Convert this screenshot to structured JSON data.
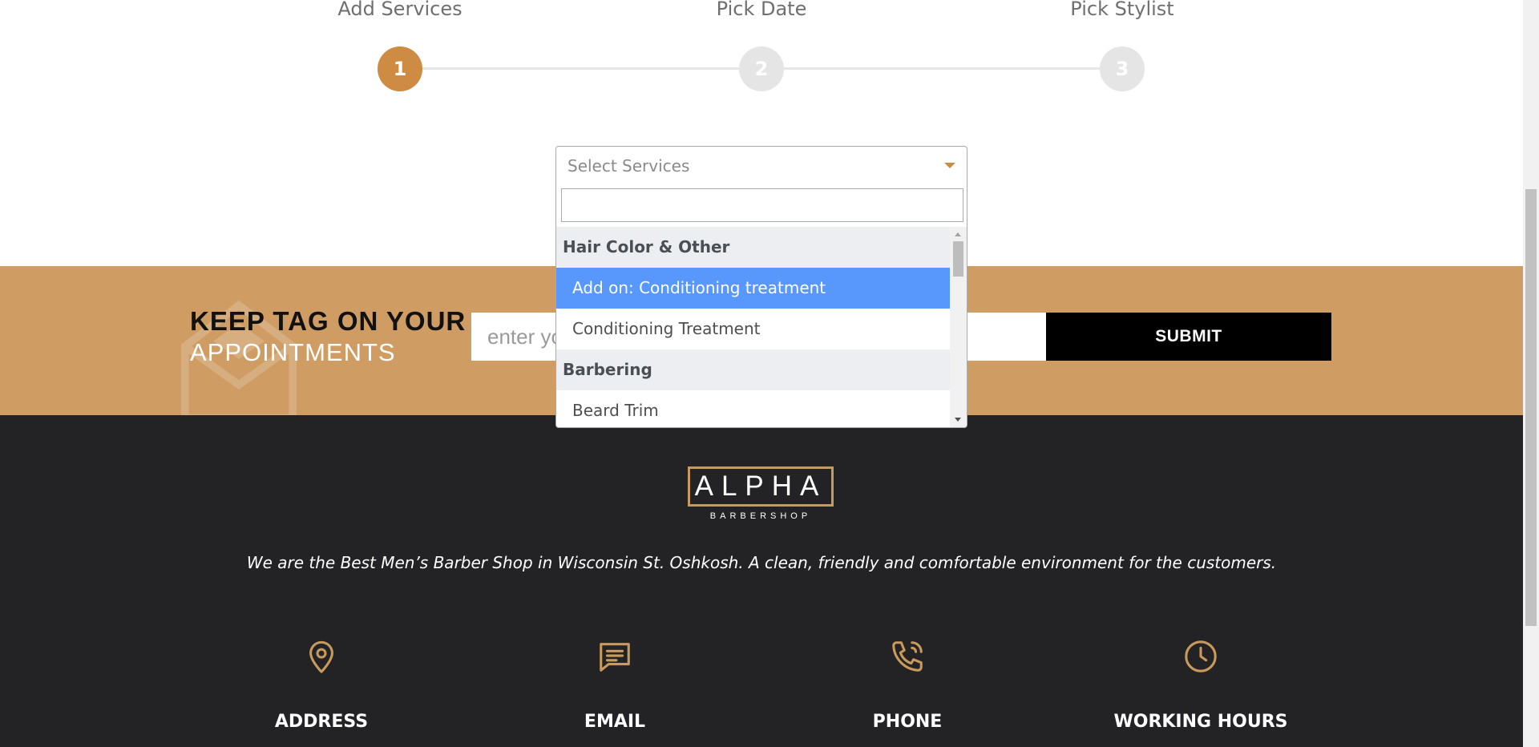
{
  "steps": [
    {
      "label": "Add Services",
      "number": "1",
      "active": true
    },
    {
      "label": "Pick Date",
      "number": "2",
      "active": false
    },
    {
      "label": "Pick Stylist",
      "number": "3",
      "active": false
    }
  ],
  "select": {
    "placeholder": "Select Services",
    "search_value": "",
    "options": [
      {
        "type": "group",
        "label": "Hair Color & Other"
      },
      {
        "type": "option",
        "label": "Add on: Conditioning treatment",
        "highlighted": true
      },
      {
        "type": "option",
        "label": "Conditioning Treatment",
        "highlighted": false
      },
      {
        "type": "group",
        "label": "Barbering"
      },
      {
        "type": "option",
        "label": "Beard Trim",
        "highlighted": false
      }
    ]
  },
  "newsletter": {
    "title_line1": "KEEP TAG ON YOUR",
    "title_line2": "APPOINTMENTS",
    "email_placeholder": "enter your email",
    "submit_label": "SUBMIT"
  },
  "footer": {
    "logo_text": "ALPHA",
    "logo_subtext": "BARBERSHOP",
    "tagline": "We are the Best Men’s Barber Shop in Wisconsin St. Oshkosh. A clean, friendly and comfortable environment for the customers.",
    "info": [
      {
        "icon": "location-pin-icon",
        "title": "ADDRESS"
      },
      {
        "icon": "chat-message-icon",
        "title": "EMAIL"
      },
      {
        "icon": "phone-icon",
        "title": "PHONE"
      },
      {
        "icon": "clock-icon",
        "title": "WORKING HOURS"
      }
    ]
  },
  "colors": {
    "accent": "#cd8b43",
    "band": "#cf9c63",
    "footer_bg": "#232325",
    "highlight": "#5897fb"
  }
}
